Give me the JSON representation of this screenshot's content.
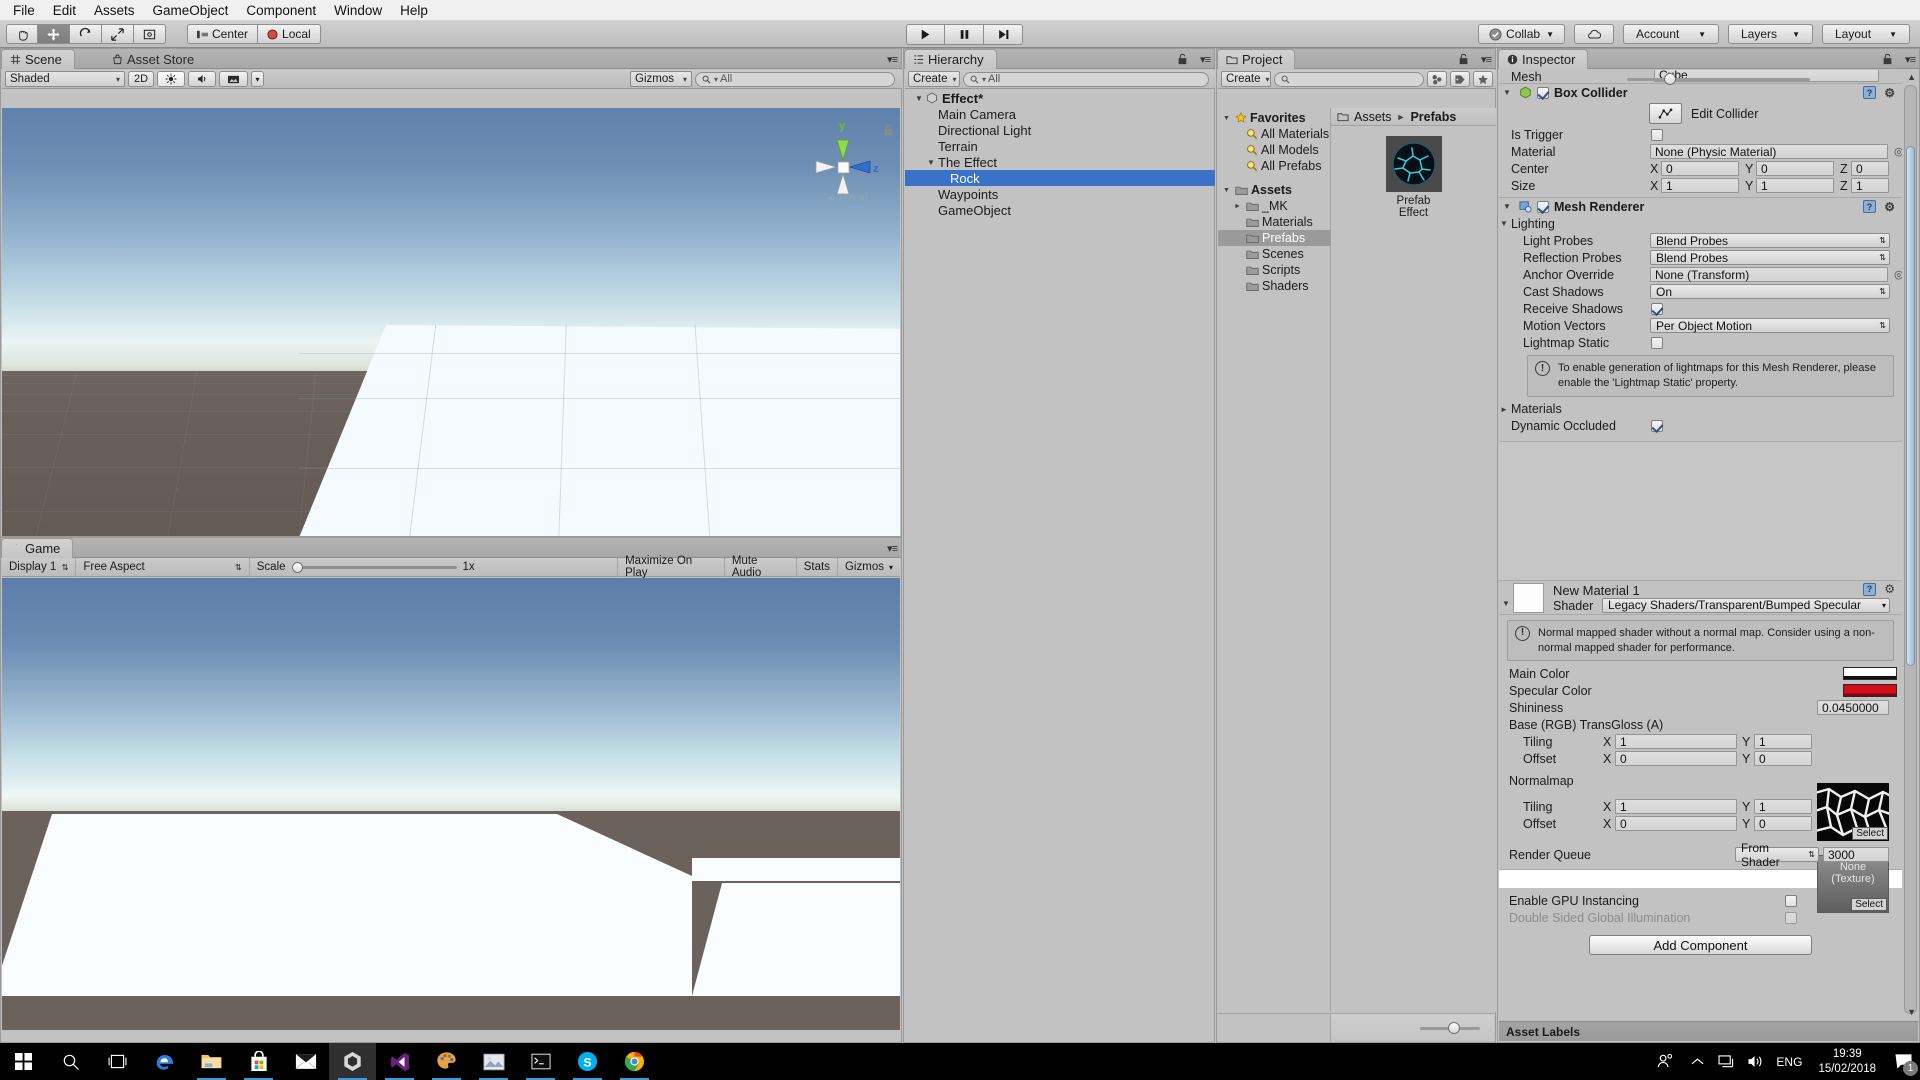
{
  "menu": {
    "items": [
      "File",
      "Edit",
      "Assets",
      "GameObject",
      "Component",
      "Window",
      "Help"
    ]
  },
  "toolbar": {
    "tools": [
      "hand-tool",
      "move-tool",
      "rotate-tool",
      "scale-tool",
      "rect-tool"
    ],
    "pivot_mode": "Center",
    "pivot_rotation": "Local",
    "play": "play",
    "pause": "pause",
    "step": "step",
    "collab": "Collab",
    "cloud": "cloud-icon",
    "account": "Account",
    "layers": "Layers",
    "layout": "Layout"
  },
  "scene": {
    "tab": "Scene",
    "tab_inactive": "Asset Store",
    "draw_mode": "Shaded",
    "mode_2d": "2D",
    "gizmos": "Gizmos",
    "search_placeholder": "All",
    "persp_label": "Persp",
    "axis_y": "y",
    "axis_z": "z"
  },
  "game": {
    "tab": "Game",
    "display": "Display 1",
    "aspect": "Free Aspect",
    "scale_label": "Scale",
    "scale_value": "1x",
    "maximize": "Maximize On Play",
    "mute": "Mute Audio",
    "stats": "Stats",
    "gizmos": "Gizmos"
  },
  "hierarchy": {
    "tab": "Hierarchy",
    "create": "Create",
    "search_placeholder": "All",
    "items": [
      {
        "label": "Effect*",
        "depth": 0,
        "arrow": "down",
        "bold": true,
        "selected": false,
        "icon": "scene-icon"
      },
      {
        "label": "Main Camera",
        "depth": 1,
        "arrow": "none",
        "bold": false,
        "selected": false
      },
      {
        "label": "Directional Light",
        "depth": 1,
        "arrow": "none",
        "bold": false,
        "selected": false
      },
      {
        "label": "Terrain",
        "depth": 1,
        "arrow": "none",
        "bold": false,
        "selected": false
      },
      {
        "label": "The Effect",
        "depth": 1,
        "arrow": "down",
        "bold": false,
        "selected": false
      },
      {
        "label": "Rock",
        "depth": 2,
        "arrow": "none",
        "bold": false,
        "selected": true
      },
      {
        "label": "Waypoints",
        "depth": 1,
        "arrow": "none",
        "bold": false,
        "selected": false
      },
      {
        "label": "GameObject",
        "depth": 1,
        "arrow": "none",
        "bold": false,
        "selected": false
      }
    ]
  },
  "project": {
    "tab": "Project",
    "create": "Create",
    "search_placeholder": "",
    "tree": [
      {
        "label": "Favorites",
        "depth": 0,
        "arrow": "down",
        "bold": true,
        "icon": "star-icon",
        "selected": false
      },
      {
        "label": "All Materials",
        "depth": 1,
        "arrow": "none",
        "bold": false,
        "icon": "search-icon",
        "selected": false
      },
      {
        "label": "All Models",
        "depth": 1,
        "arrow": "none",
        "bold": false,
        "icon": "search-icon",
        "selected": false
      },
      {
        "label": "All Prefabs",
        "depth": 1,
        "arrow": "none",
        "bold": false,
        "icon": "search-icon",
        "selected": false
      },
      {
        "label": "",
        "depth": 0,
        "arrow": "none",
        "bold": false,
        "icon": "none",
        "selected": false
      },
      {
        "label": "Assets",
        "depth": 0,
        "arrow": "down",
        "bold": true,
        "icon": "folder-icon",
        "selected": false
      },
      {
        "label": "_MK",
        "depth": 1,
        "arrow": "right",
        "bold": false,
        "icon": "folder-icon",
        "selected": false
      },
      {
        "label": "Materials",
        "depth": 1,
        "arrow": "none",
        "bold": false,
        "icon": "folder-icon",
        "selected": false
      },
      {
        "label": "Prefabs",
        "depth": 1,
        "arrow": "none",
        "bold": false,
        "icon": "folder-icon",
        "selected": true
      },
      {
        "label": "Scenes",
        "depth": 1,
        "arrow": "none",
        "bold": false,
        "icon": "folder-icon",
        "selected": false
      },
      {
        "label": "Scripts",
        "depth": 1,
        "arrow": "none",
        "bold": false,
        "icon": "folder-icon",
        "selected": false
      },
      {
        "label": "Shaders",
        "depth": 1,
        "arrow": "none",
        "bold": false,
        "icon": "folder-icon",
        "selected": false
      }
    ],
    "breadcrumb": [
      "Assets",
      "Prefabs"
    ],
    "assets": [
      {
        "label": "Prefab Effect",
        "thumb": "rock-sphere-thumb"
      }
    ]
  },
  "inspector": {
    "tab": "Inspector",
    "mesh_row_label": "Mesh",
    "mesh_row_value": "Cube",
    "box_collider": {
      "title": "Box Collider",
      "enabled": true,
      "edit_collider": "Edit Collider",
      "is_trigger_label": "Is Trigger",
      "is_trigger": false,
      "material_label": "Material",
      "material_value": "None (Physic Material)",
      "center_label": "Center",
      "center": {
        "x": "0",
        "y": "0",
        "z": "0"
      },
      "size_label": "Size",
      "size": {
        "x": "1",
        "y": "1",
        "z": "1"
      }
    },
    "mesh_renderer": {
      "title": "Mesh Renderer",
      "enabled": true,
      "lighting_label": "Lighting",
      "light_probes_label": "Light Probes",
      "light_probes": "Blend Probes",
      "reflection_probes_label": "Reflection Probes",
      "reflection_probes": "Blend Probes",
      "anchor_override_label": "Anchor Override",
      "anchor_override": "None (Transform)",
      "cast_shadows_label": "Cast Shadows",
      "cast_shadows": "On",
      "receive_shadows_label": "Receive Shadows",
      "receive_shadows": true,
      "motion_vectors_label": "Motion Vectors",
      "motion_vectors": "Per Object Motion",
      "lightmap_static_label": "Lightmap Static",
      "lightmap_static": false,
      "help_text": "To enable generation of lightmaps for this Mesh Renderer, please enable the 'Lightmap Static' property.",
      "materials_label": "Materials",
      "dynamic_occluded_label": "Dynamic Occluded",
      "dynamic_occluded": true
    },
    "material": {
      "name": "New Material 1",
      "shader_label": "Shader",
      "shader_value": "Legacy Shaders/Transparent/Bumped Specular",
      "help_text": "Normal mapped shader without a normal map. Consider using a non-normal mapped shader for performance.",
      "main_color_label": "Main Color",
      "main_color": "#ffffff",
      "specular_color_label": "Specular Color",
      "specular_color": "#d40d16",
      "shininess_label": "Shininess",
      "shininess_value": "0.0450000",
      "base_label": "Base (RGB) TransGloss (A)",
      "base_tiling_label": "Tiling",
      "base_tiling": {
        "x": "1",
        "y": "1"
      },
      "base_offset_label": "Offset",
      "base_offset": {
        "x": "0",
        "y": "0"
      },
      "base_select": "Select",
      "normalmap_label": "Normalmap",
      "normalmap_none": "None",
      "normalmap_none_sub": "(Texture)",
      "normal_tiling_label": "Tiling",
      "normal_tiling": {
        "x": "1",
        "y": "1"
      },
      "normal_offset_label": "Offset",
      "normal_offset": {
        "x": "0",
        "y": "0"
      },
      "normal_select": "Select",
      "render_queue_label": "Render Queue",
      "render_queue_mode": "From Shader",
      "render_queue_value": "3000",
      "gpu_instancing_label": "Enable GPU Instancing",
      "gpu_instancing": false,
      "double_sided_label": "Double Sided Global Illumination",
      "double_sided": false
    },
    "add_component": "Add Component",
    "asset_labels": "Asset Labels",
    "axis_x": "X",
    "axis_y": "Y",
    "axis_z": "Z"
  },
  "taskbar": {
    "start": "windows-start-icon",
    "apps": [
      {
        "name": "search-icon",
        "active": false,
        "running": false
      },
      {
        "name": "task-view-icon",
        "active": false,
        "running": false
      },
      {
        "name": "edge-icon",
        "active": false,
        "running": false
      },
      {
        "name": "file-explorer-icon",
        "active": false,
        "running": true
      },
      {
        "name": "microsoft-store-icon",
        "active": false,
        "running": true
      },
      {
        "name": "mail-icon",
        "active": false,
        "running": false
      },
      {
        "name": "unity-icon",
        "active": true,
        "running": true
      },
      {
        "name": "visual-studio-icon",
        "active": false,
        "running": true
      },
      {
        "name": "paint-icon",
        "active": false,
        "running": true
      },
      {
        "name": "photo-viewer-icon",
        "active": false,
        "running": true
      },
      {
        "name": "command-prompt-icon",
        "active": false,
        "running": true
      },
      {
        "name": "skype-icon",
        "active": false,
        "running": true
      },
      {
        "name": "chrome-icon",
        "active": false,
        "running": true
      }
    ],
    "tray": {
      "people_icon": "people-icon",
      "chevron_icon": "show-hidden-icons",
      "network_icon": "network-icon",
      "volume_icon": "volume-icon",
      "language": "ENG",
      "time": "19:39",
      "date": "15/02/2018",
      "notification_count": "1"
    }
  },
  "colors": {
    "selection_blue": "#3a72c9",
    "panel_bg": "#c2c2c2",
    "toolbar_bg": "#cfcfcf"
  }
}
